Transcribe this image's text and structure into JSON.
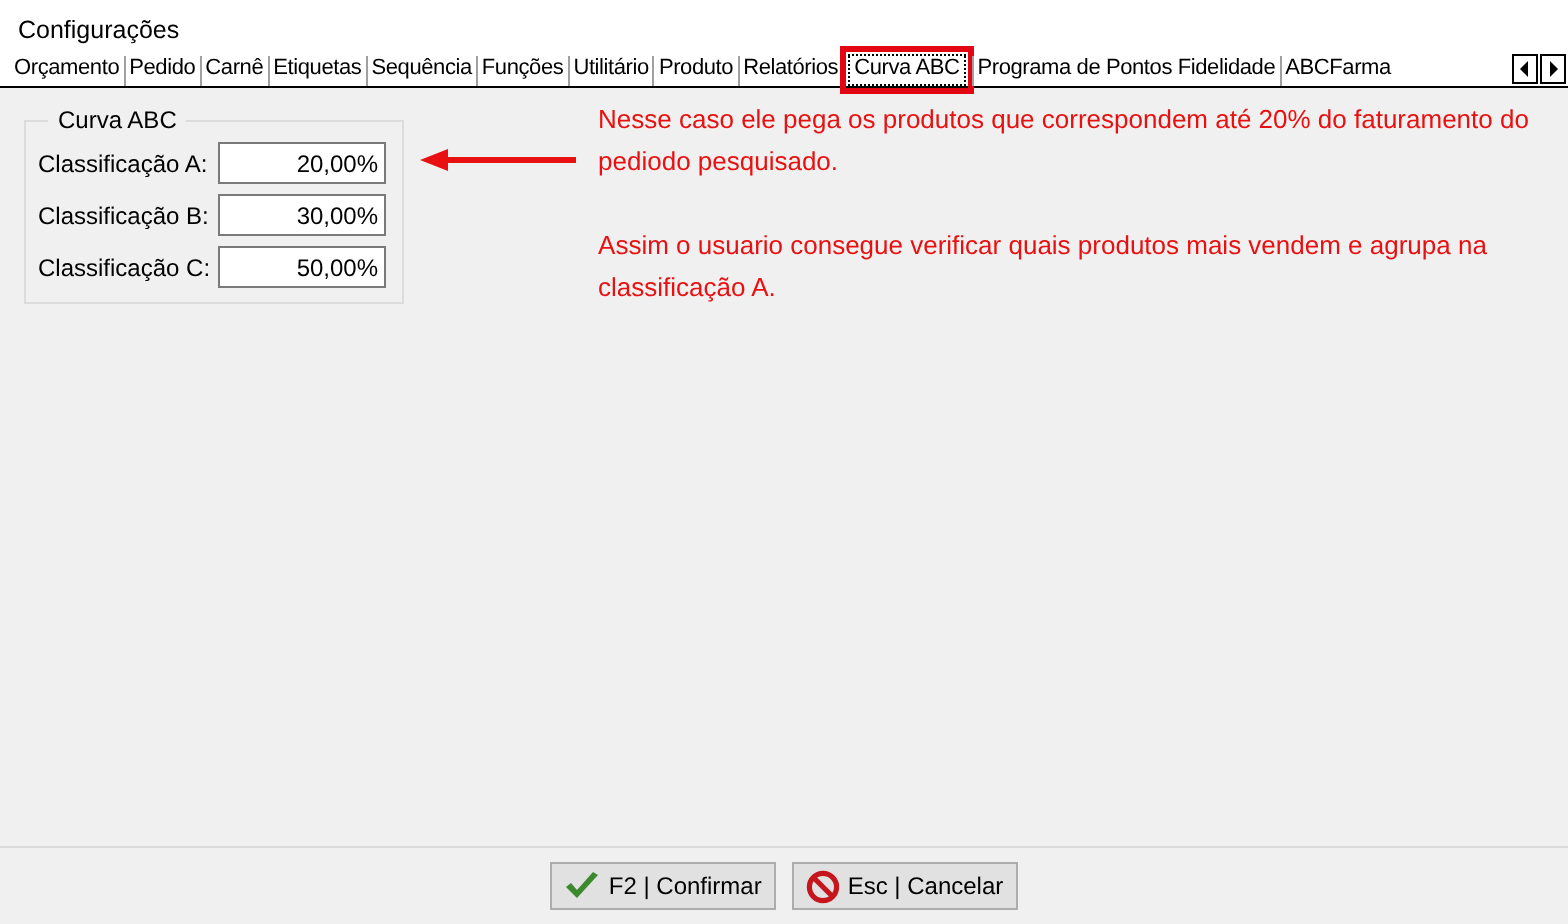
{
  "window": {
    "title": "Configurações"
  },
  "tabs": [
    {
      "label": "Orçamento",
      "selected": false
    },
    {
      "label": "Pedido",
      "selected": false
    },
    {
      "label": "Carnê",
      "selected": false
    },
    {
      "label": "Etiquetas",
      "selected": false
    },
    {
      "label": "Sequência",
      "selected": false
    },
    {
      "label": "Funções",
      "selected": false
    },
    {
      "label": "Utilitário",
      "selected": false
    },
    {
      "label": "Produto",
      "selected": false
    },
    {
      "label": "Relatórios",
      "selected": false
    },
    {
      "label": "Curva ABC",
      "selected": true
    },
    {
      "label": "Programa de Pontos Fidelidade",
      "selected": false
    },
    {
      "label": "ABCFarma",
      "selected": false
    }
  ],
  "group": {
    "title": "Curva ABC",
    "fields": [
      {
        "label": "Classificação A:",
        "value": "20,00%"
      },
      {
        "label": "Classificação B:",
        "value": "30,00%"
      },
      {
        "label": "Classificação C:",
        "value": "50,00%"
      }
    ]
  },
  "annotation": {
    "paragraphs": [
      "Nesse caso ele pega os produtos que correspondem até 20% do faturamento do pediodo pesquisado.",
      "Assim o usuario consegue verificar quais produtos mais vendem e agrupa na classificação A."
    ]
  },
  "buttons": [
    {
      "kind": "confirm",
      "label": "F2 | Confirmar"
    },
    {
      "kind": "cancel",
      "label": "Esc | Cancelar"
    }
  ]
}
